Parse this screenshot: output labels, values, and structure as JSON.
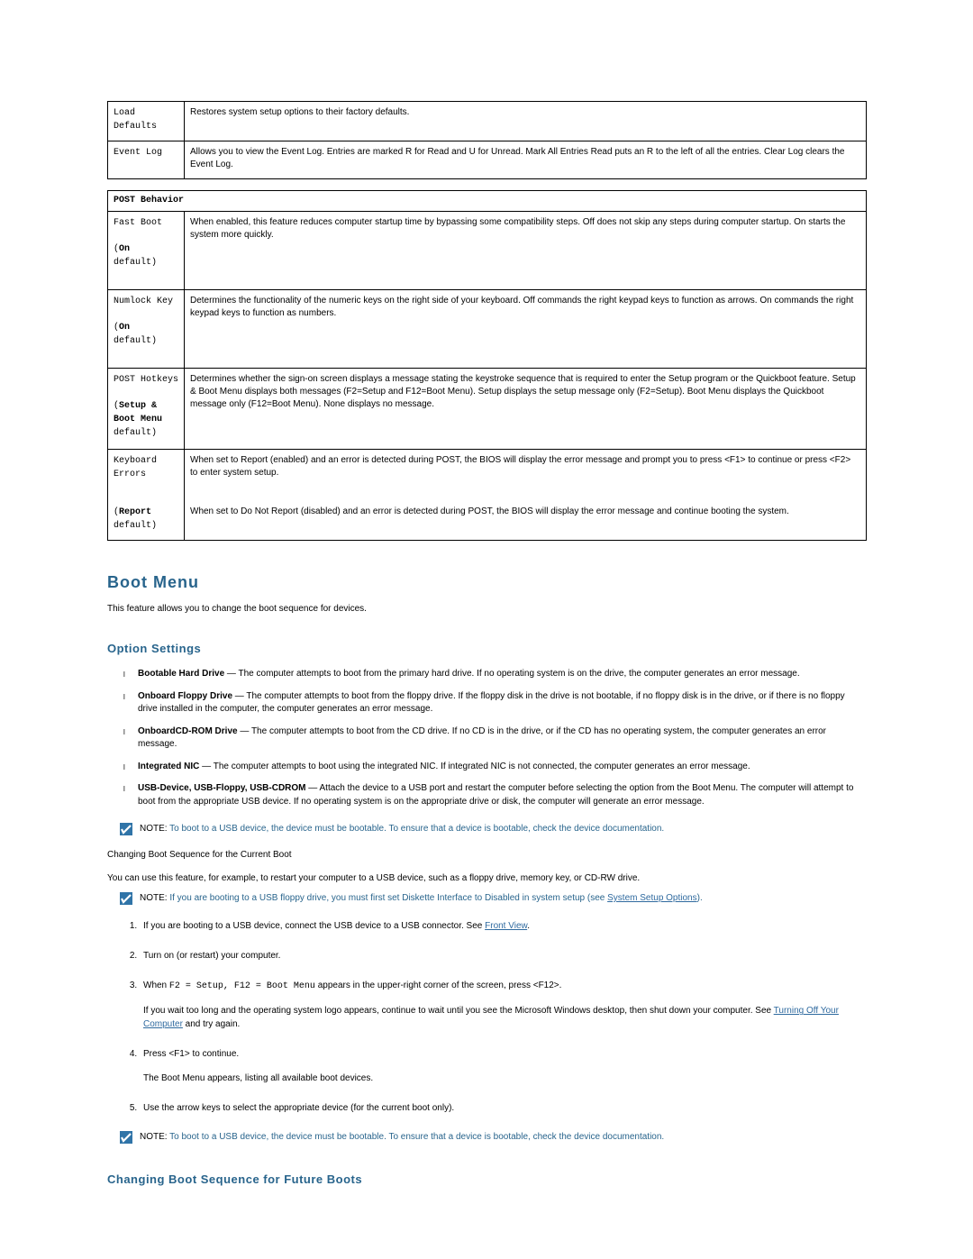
{
  "table1": {
    "rows": [
      {
        "label": "Load Defaults",
        "desc": "Restores system setup options to their factory defaults."
      },
      {
        "label": "Event Log",
        "desc": "Allows you to view the Event Log. Entries are marked R for Read and U for Unread. Mark All Entries Read puts an R to the left of all the entries. Clear Log clears the Event Log."
      }
    ]
  },
  "table2": {
    "header": "POST Behavior",
    "rows": [
      {
        "label": "Fast Boot",
        "default_bold": "On",
        "default_rest": " default)",
        "desc": "When enabled, this feature reduces computer startup time by bypassing some compatibility steps. Off does not skip any steps during computer startup. On starts the system more quickly."
      },
      {
        "label": "Numlock Key",
        "default_bold": "On",
        "default_rest": " default)",
        "desc": "Determines the functionality of the numeric keys on the right side of your keyboard. Off commands the right keypad keys to function as arrows. On commands the right keypad keys to function as numbers."
      },
      {
        "label": "POST Hotkeys",
        "default_bold": "Setup & Boot Menu",
        "default_rest": " default)",
        "desc": "Determines whether the sign-on screen displays a message stating the keystroke sequence that is required to enter the Setup program or the Quickboot feature. Setup & Boot Menu displays both messages (F2=Setup and F12=Boot Menu). Setup displays the setup message only (F2=Setup). Boot Menu displays the Quickboot message only (F12=Boot Menu). None displays no message."
      },
      {
        "label": "Keyboard Errors",
        "default_bold": "Report",
        "default_rest": " default)",
        "desc1": "When set to Report (enabled) and an error is detected during POST, the BIOS will display the error message and prompt you to press <F1> to continue or press <F2> to enter system setup.",
        "desc2": "When set to Do Not Report (disabled) and an error is detected during POST, the BIOS will display the error message and continue booting the system."
      }
    ]
  },
  "boot_menu": {
    "heading": "Boot Menu",
    "intro": "This feature allows you to change the boot sequence for devices.",
    "option_settings_heading": "Option Settings",
    "options": [
      {
        "bold": "Bootable Hard Drive",
        "rest": " — The computer attempts to boot from the primary hard drive. If no operating system is on the drive, the computer generates an error message."
      },
      {
        "bold": "Onboard Floppy Drive",
        "rest": " — The computer attempts to boot from the floppy drive. If the floppy disk in the drive is not bootable, if no floppy disk is in the drive, or if there is no floppy drive installed in the computer, the computer generates an error message."
      },
      {
        "bold": "OnboardCD-ROM Drive",
        "rest": " — The computer attempts to boot from the CD drive. If no CD is in the drive, or if the CD has no operating system, the computer generates an error message."
      },
      {
        "bold": "Integrated NIC",
        "rest": " — The computer attempts to boot using the integrated NIC. If integrated NIC is not connected, the computer generates an error message."
      },
      {
        "bold": "USB-Device, USB-Floppy, USB-CDROM",
        "rest": " — Attach the device to a USB port and restart the computer before selecting the option from the Boot Menu. The computer will attempt to boot from the appropriate USB device. If no operating system is on the appropriate drive or disk, the computer will generate an error message."
      }
    ],
    "note1": {
      "label": "NOTE:",
      "text": " To boot to a USB device, the device must be bootable. To ensure that a device is bootable, check the device documentation."
    },
    "sub1": "Changing Boot Sequence for the Current Boot",
    "sub1_text": "You can use this feature, for example, to restart your computer to a USB device, such as a floppy drive, memory key, or CD-RW drive.",
    "note2": {
      "label": "NOTE:",
      "text_before": " If you are booting to a USB floppy drive, you must first set Diskette Interface to Disabled in system setup (see ",
      "link": "System Setup Options",
      "text_after": ")."
    },
    "steps": {
      "s1_before": "If you are booting to a USB device, connect the USB device to a USB connector. See ",
      "s1_link": "Front View",
      "s1_after": ".",
      "s2": "Turn on (or restart) your computer.",
      "s3_before": "When ",
      "s3_code": "F2 = Setup, F12 = Boot Menu",
      "s3_after": " appears in the upper-right corner of the screen, press <F12>.",
      "s3_sub_before": "If you wait too long and the operating system logo appears, continue to wait until you see the Microsoft Windows desktop, then shut down your computer. See ",
      "s3_sub_link": "Turning Off Your Computer",
      "s3_sub_after": " and try again.",
      "s4": "Press <F1> to continue.",
      "s4_sub": "The Boot Menu appears, listing all available boot devices.",
      "s5": "Use the arrow keys to select the appropriate device (for the current boot only)."
    },
    "note3": {
      "label": "NOTE:",
      "text": " To boot to a USB device, the device must be bootable. To ensure that a device is bootable, check the device documentation."
    },
    "future_heading": "Changing Boot Sequence for Future Boots"
  }
}
